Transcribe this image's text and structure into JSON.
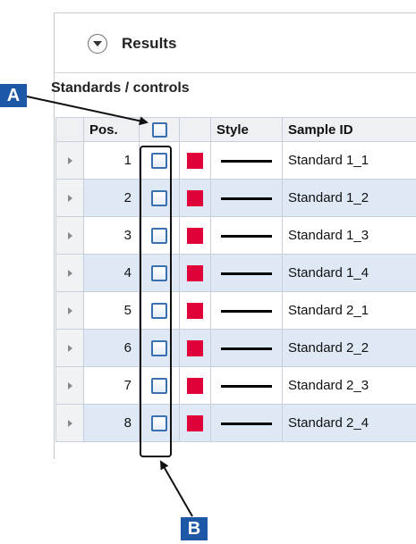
{
  "panel": {
    "title": "Results"
  },
  "section": {
    "title": "Standards / controls"
  },
  "table": {
    "headers": {
      "pos": "Pos.",
      "style": "Style",
      "sample_id": "Sample ID"
    },
    "rows": [
      {
        "pos": "1",
        "sample_id": "Standard 1_1"
      },
      {
        "pos": "2",
        "sample_id": "Standard 1_2"
      },
      {
        "pos": "3",
        "sample_id": "Standard 1_3"
      },
      {
        "pos": "4",
        "sample_id": "Standard 1_4"
      },
      {
        "pos": "5",
        "sample_id": "Standard 2_1"
      },
      {
        "pos": "6",
        "sample_id": "Standard 2_2"
      },
      {
        "pos": "7",
        "sample_id": "Standard 2_3"
      },
      {
        "pos": "8",
        "sample_id": "Standard 2_4"
      }
    ],
    "swatch_color": "#e0003a",
    "line_color": "#000000"
  },
  "callouts": {
    "a": "A",
    "b": "B",
    "color": "#1d58a6"
  }
}
